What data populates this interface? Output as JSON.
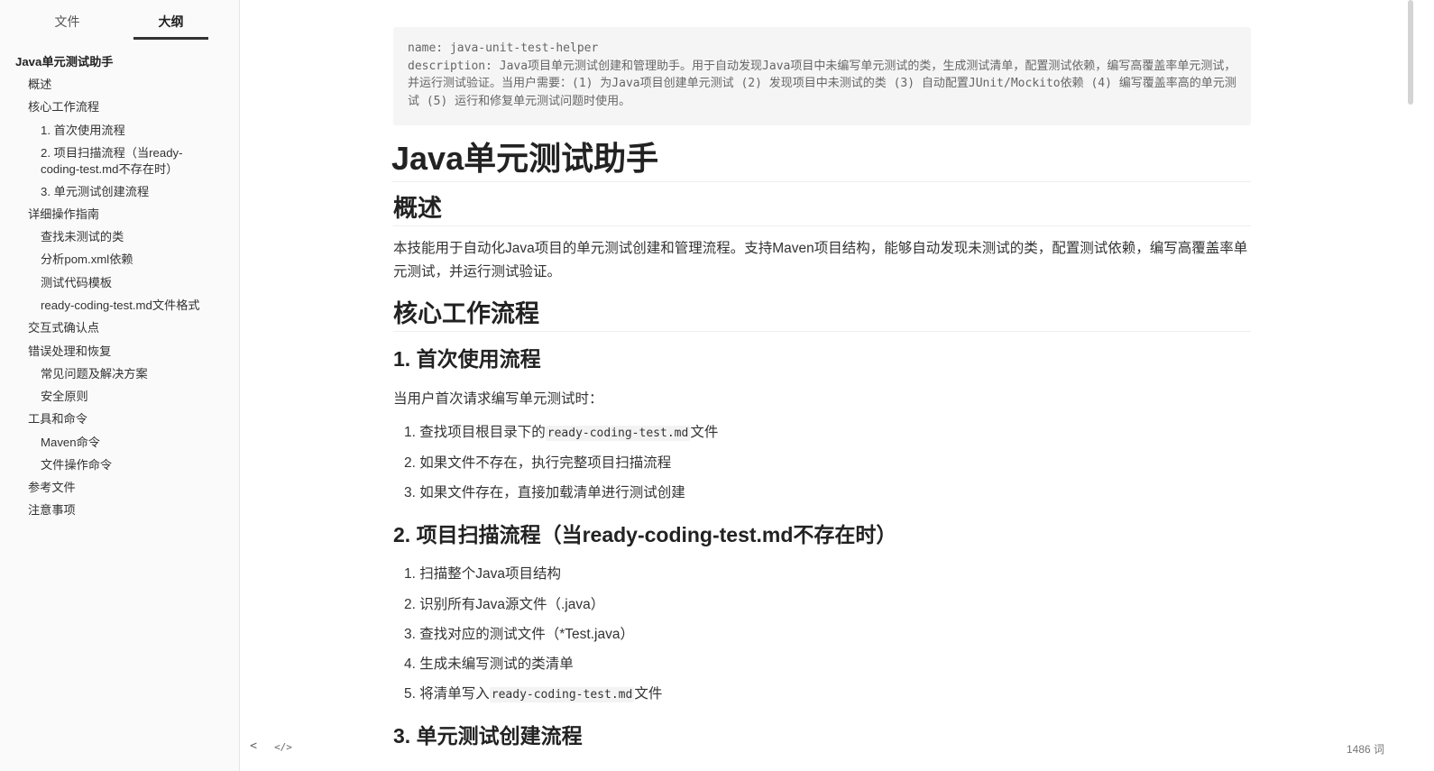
{
  "sidebar": {
    "tabs": {
      "files": "文件",
      "outline": "大纲"
    },
    "outline": [
      {
        "label": "Java单元测试助手"
      },
      {
        "label": "概述"
      },
      {
        "label": "核心工作流程"
      },
      {
        "label": "1. 首次使用流程"
      },
      {
        "label": "2. 项目扫描流程（当ready-coding-test.md不存在时）"
      },
      {
        "label": "3. 单元测试创建流程"
      },
      {
        "label": "详细操作指南"
      },
      {
        "label": "查找未测试的类"
      },
      {
        "label": "分析pom.xml依赖"
      },
      {
        "label": "测试代码模板"
      },
      {
        "label": "ready-coding-test.md文件格式"
      },
      {
        "label": "交互式确认点"
      },
      {
        "label": "错误处理和恢复"
      },
      {
        "label": "常见问题及解决方案"
      },
      {
        "label": "安全原则"
      },
      {
        "label": "工具和命令"
      },
      {
        "label": "Maven命令"
      },
      {
        "label": "文件操作命令"
      },
      {
        "label": "参考文件"
      },
      {
        "label": "注意事项"
      }
    ],
    "footer": {
      "prev_icon": "<",
      "source_icon": "</>"
    }
  },
  "document": {
    "frontmatter": {
      "name_line": "name: java-unit-test-helper",
      "description_line": "description: Java项目单元测试创建和管理助手。用于自动发现Java项目中未编写单元测试的类，生成测试清单，配置测试依赖，编写高覆盖率单元测试，并运行测试验证。当用户需要：(1) 为Java项目创建单元测试 (2) 发现项目中未测试的类 (3) 自动配置JUnit/Mockito依赖 (4) 编写覆盖率高的单元测试 (5) 运行和修复单元测试问题时使用。"
    },
    "h1": "Java单元测试助手",
    "overview_heading": "概述",
    "overview_text": "本技能用于自动化Java项目的单元测试创建和管理流程。支持Maven项目结构，能够自动发现未测试的类，配置测试依赖，编写高覆盖率单元测试，并运行测试验证。",
    "workflow_heading": "核心工作流程",
    "first_use": {
      "heading": "1. 首次使用流程",
      "intro": "当用户首次请求编写单元测试时：",
      "items": [
        {
          "num": "1.",
          "before": "查找项目根目录下的",
          "code": "ready-coding-test.md",
          "after": "文件"
        },
        {
          "num": "2.",
          "text": "如果文件不存在，执行完整项目扫描流程"
        },
        {
          "num": "3.",
          "text": "如果文件存在，直接加载清单进行测试创建"
        }
      ]
    },
    "scan": {
      "heading": "2. 项目扫描流程（当ready-coding-test.md不存在时）",
      "items": [
        {
          "num": "1.",
          "text": "扫描整个Java项目结构"
        },
        {
          "num": "2.",
          "text": "识别所有Java源文件（.java）"
        },
        {
          "num": "3.",
          "text": "查找对应的测试文件（*Test.java）"
        },
        {
          "num": "4.",
          "text": "生成未编写测试的类清单"
        },
        {
          "num": "5.",
          "before": "将清单写入",
          "code": "ready-coding-test.md",
          "after": "文件"
        }
      ]
    },
    "create_heading": "3. 单元测试创建流程"
  },
  "status": {
    "word_count": "1486 词"
  },
  "colors": {
    "sidebar_bg": "#fafafa",
    "frontmatter_bg": "#f5f5f5",
    "text": "#333333",
    "heading": "#222222"
  }
}
